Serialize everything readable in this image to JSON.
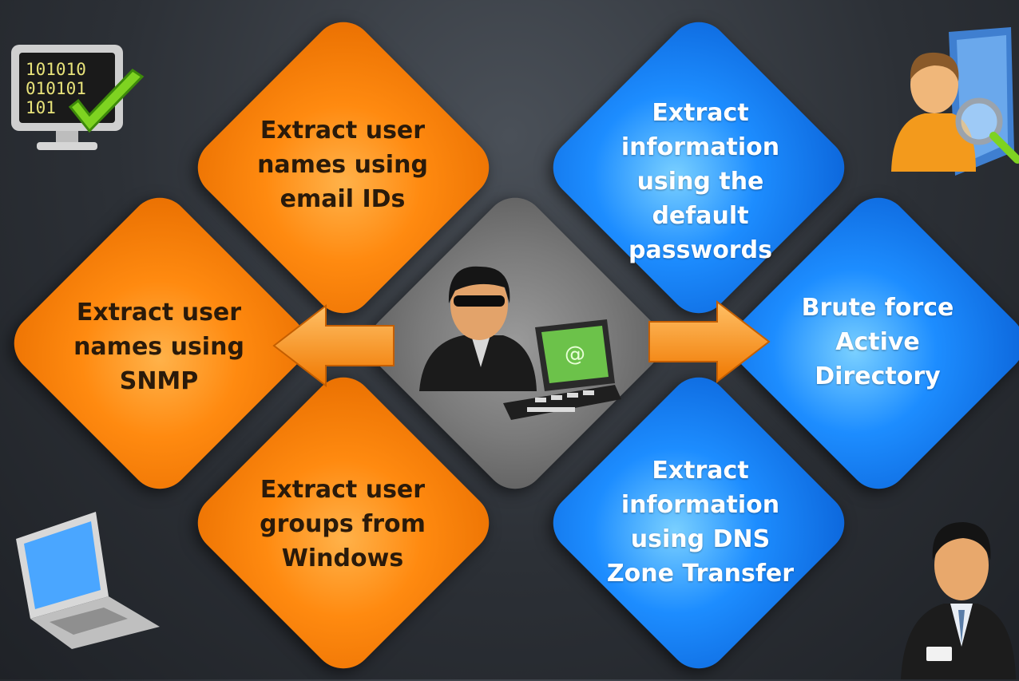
{
  "diagram": {
    "top_left": "Extract user names using email IDs",
    "left": "Extract user names using SNMP",
    "bottom_left": "Extract user groups from Windows",
    "top_right": "Extract information using the default passwords",
    "right": "Brute force Active Directory",
    "bottom_right": "Extract information using DNS Zone Transfer"
  },
  "monitor_binary": {
    "line1": "101010",
    "line2": "010101",
    "line3": "101"
  },
  "laptop_screen_symbol": "@",
  "colors": {
    "orange": "#ff8a10",
    "blue": "#1d8dff",
    "gray": "#7a7a7a",
    "background": "#2c3036"
  },
  "icons": [
    "monitor-check-icon",
    "user-search-folder-icon",
    "laptop-icon",
    "businessman-icon",
    "hacker-laptop-icon",
    "arrow-left-icon",
    "arrow-right-icon"
  ]
}
